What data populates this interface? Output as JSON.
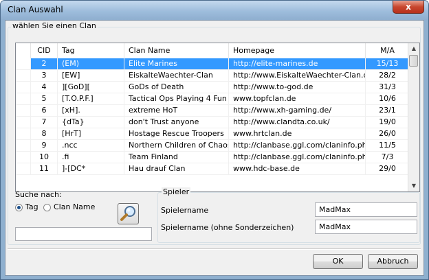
{
  "window": {
    "title": "Clan Auswahl",
    "close_glyph": "x"
  },
  "clan_group": {
    "label": "wählen Sie einen Clan",
    "columns": [
      "CID",
      "Tag",
      "Clan Name",
      "Homepage",
      "M/A"
    ],
    "rows": [
      {
        "cid": "2",
        "tag": "(EM)",
        "name": "Elite Marines",
        "homepage": "http://elite-marines.de",
        "ma": "15/13",
        "selected": true
      },
      {
        "cid": "3",
        "tag": "[EW]",
        "name": "EiskalteWaechter-Clan",
        "homepage": "http://www.EiskalteWaechter-Clan.de",
        "ma": "28/2"
      },
      {
        "cid": "4",
        "tag": "][GoD][",
        "name": "GoDs of Death",
        "homepage": "http://www.to-god.de",
        "ma": "31/3"
      },
      {
        "cid": "5",
        "tag": "[T.O.P.F.]",
        "name": "Tactical Ops Playing 4 Fun",
        "homepage": "www.topfclan.de",
        "ma": "10/6"
      },
      {
        "cid": "6",
        "tag": "[xH].",
        "name": "extreme HoT",
        "homepage": "http://www.xh-gaming.de/",
        "ma": "23/1"
      },
      {
        "cid": "7",
        "tag": "{dTa}",
        "name": "don't Trust anyone",
        "homepage": "http://www.clandta.co.uk/",
        "ma": "19/0"
      },
      {
        "cid": "8",
        "tag": "[HrT]",
        "name": "Hostage Rescue Troopers",
        "homepage": "www.hrtclan.de",
        "ma": "26/0"
      },
      {
        "cid": "9",
        "tag": ".ncc",
        "name": "Northern Children of Chaos",
        "homepage": "http://clanbase.ggl.com/claninfo.ph...",
        "ma": "11/5"
      },
      {
        "cid": "10",
        "tag": ".fi",
        "name": "Team Finland",
        "homepage": "http://clanbase.ggl.com/claninfo.ph...",
        "ma": "7/3"
      },
      {
        "cid": "11",
        "tag": "]-[DC*",
        "name": "Hau drauf Clan",
        "homepage": "www.hdc-base.de",
        "ma": "29/0"
      }
    ],
    "scroll_up_glyph": "▲",
    "scroll_down_glyph": "▼"
  },
  "search": {
    "label": "Suche nach:",
    "option_tag": "Tag",
    "option_name": "Clan Name",
    "selected_option": "Tag",
    "value": "",
    "icon": "magnifier-icon"
  },
  "player": {
    "label": "Spieler",
    "name_label": "Spielername",
    "name_value": "MadMax",
    "plain_name_label": "Spielername (ohne Sonderzeichen)",
    "plain_name_value": "MadMax"
  },
  "buttons": {
    "ok": "OK",
    "cancel": "Abbruch"
  }
}
